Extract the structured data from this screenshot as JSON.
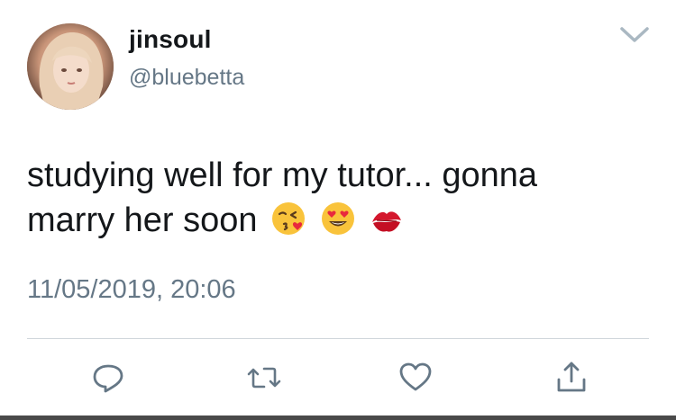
{
  "author": {
    "display_name": "jinsoul",
    "handle": "@bluebetta",
    "avatar_icon": "profile-photo"
  },
  "tweet": {
    "text_line1": "studying well for my tutor... gonna",
    "text_line2": "marry her soon",
    "emojis": [
      "face-blowing-a-kiss",
      "smiling-face-with-heart-eyes",
      "kiss-mark"
    ],
    "timestamp": "11/05/2019, 20:06"
  },
  "actions": {
    "reply_icon": "reply-icon",
    "retweet_icon": "retweet-icon",
    "like_icon": "heart-icon",
    "share_icon": "share-icon"
  },
  "colors": {
    "text_primary": "#14171a",
    "text_secondary": "#657786",
    "divider": "#cfd6db",
    "icon": "#657786"
  }
}
